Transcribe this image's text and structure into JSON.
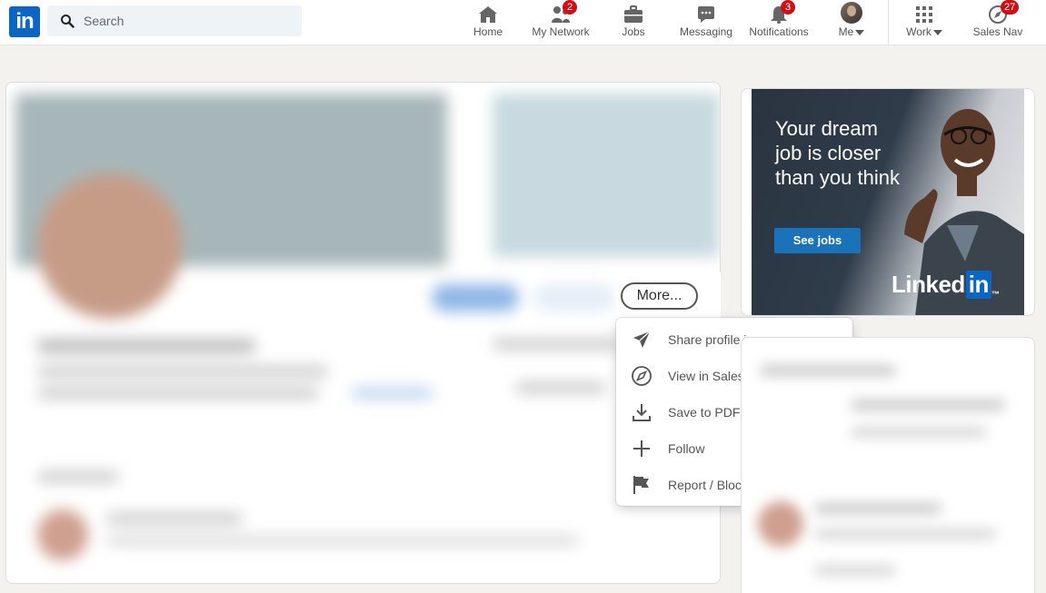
{
  "nav": {
    "logo_text": "in",
    "search_placeholder": "Search",
    "items": [
      {
        "label": "Home",
        "icon": "home-icon"
      },
      {
        "label": "My Network",
        "icon": "network-icon",
        "badge": "2"
      },
      {
        "label": "Jobs",
        "icon": "briefcase-icon"
      },
      {
        "label": "Messaging",
        "icon": "messaging-icon"
      },
      {
        "label": "Notifications",
        "icon": "bell-icon",
        "badge": "3"
      },
      {
        "label": "Me",
        "icon": "avatar"
      },
      {
        "label": "Work",
        "icon": "grid-icon"
      },
      {
        "label": "Sales Nav",
        "icon": "compass-icon",
        "badge": "27"
      }
    ]
  },
  "profile": {
    "more_label": "More..."
  },
  "dropdown": {
    "items": [
      {
        "label": "Share profile in a message",
        "icon": "send-icon"
      },
      {
        "label": "View in Sales Navigator",
        "icon": "compass-icon"
      },
      {
        "label": "Save to PDF",
        "icon": "download-icon"
      },
      {
        "label": "Follow",
        "icon": "plus-icon"
      },
      {
        "label": "Report / Block",
        "icon": "flag-icon"
      }
    ]
  },
  "ad": {
    "headline": "Your dream job is closer than you think",
    "cta": "See jobs",
    "logo_word": "Linked",
    "logo_in": "in",
    "logo_tm": "™"
  },
  "colors": {
    "brand": "#0a66c2",
    "badge": "#cc1016",
    "background": "#f3f2ef"
  }
}
